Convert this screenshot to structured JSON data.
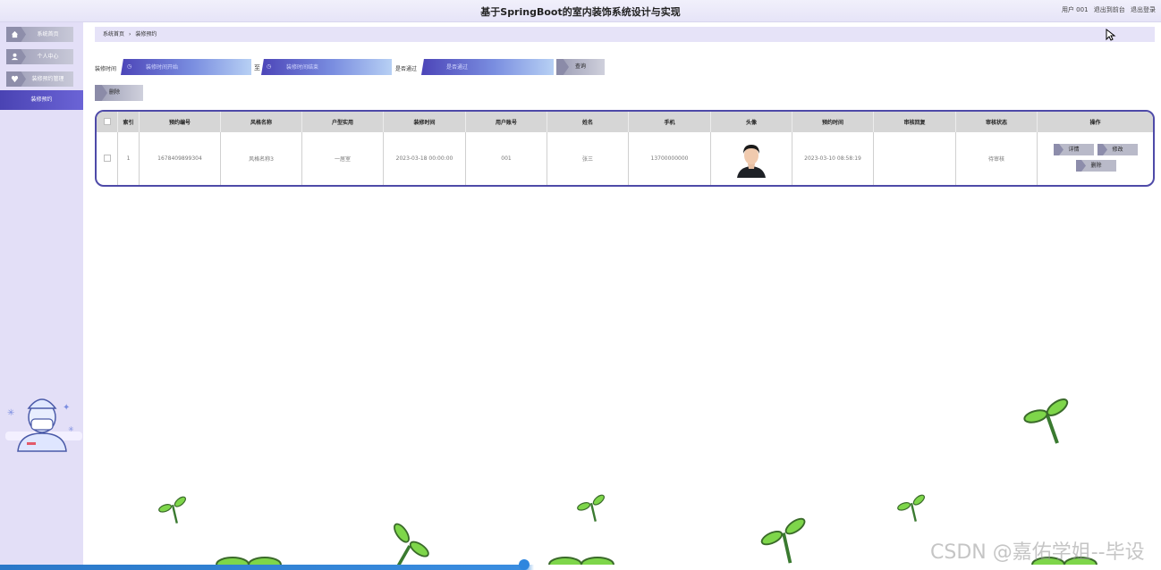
{
  "app": {
    "title": "基于SpringBoot的室内装饰系统设计与实现",
    "user_label": "用户 001",
    "back_link": "退出到前台",
    "logout_link": "退出登录"
  },
  "sidebar": {
    "items": [
      {
        "label": "系统首页",
        "icon": "home-icon"
      },
      {
        "label": "个人中心",
        "icon": "user-icon"
      },
      {
        "label": "装修预约管理",
        "icon": "heart-icon"
      }
    ],
    "active": {
      "label": "装修预约"
    }
  },
  "breadcrumb": {
    "home": "系统首页",
    "sep": "›",
    "current": "装修预约"
  },
  "search": {
    "date_label": "装修时间",
    "start_placeholder": "装修时间开始",
    "to_label": "至",
    "end_placeholder": "装修时间结束",
    "review_label": "是否通过",
    "review_placeholder": "是否通过",
    "query_button": "查询",
    "delete_button": "删除"
  },
  "table": {
    "columns": [
      "索引",
      "预约编号",
      "风格名称",
      "户型实用",
      "装修时间",
      "用户账号",
      "姓名",
      "手机",
      "头像",
      "预约时间",
      "审核回复",
      "审核状态",
      "操作"
    ],
    "rows": [
      {
        "index": "1",
        "booking_no": "1678409899304",
        "style_name": "风格名称3",
        "house_type": "一居室",
        "renovate_time": "2023-03-18 00:00:00",
        "account": "001",
        "name": "张三",
        "phone": "13700000000",
        "booking_time": "2023-03-10 08:58:19",
        "review_reply": "",
        "review_status": "待审核"
      }
    ],
    "actions": {
      "detail": "详情",
      "edit": "修改",
      "delete": "删除"
    }
  },
  "watermark": "CSDN @嘉佑学姐--毕设"
}
